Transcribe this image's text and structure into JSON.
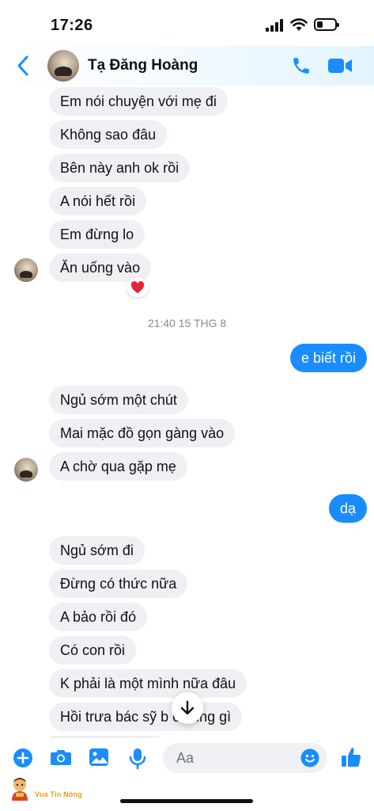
{
  "status_bar": {
    "time": "17:26"
  },
  "header": {
    "contact_name": "Tạ Đăng Hoàng"
  },
  "messages": [
    {
      "dir": "in",
      "text": "Em nói chuyện với mẹ đi"
    },
    {
      "dir": "in",
      "text": "Không sao đâu"
    },
    {
      "dir": "in",
      "text": "Bên này anh ok rồi"
    },
    {
      "dir": "in",
      "text": "A nói hết rồi"
    },
    {
      "dir": "in",
      "text": "Em đừng lo"
    },
    {
      "dir": "in",
      "text": "Ăn uống vào",
      "reaction": "❤️"
    },
    {
      "dir": "in",
      "text": "Ngủ sớm một chút"
    },
    {
      "dir": "in",
      "text": "Mai mặc đồ gọn gàng vào"
    },
    {
      "dir": "in",
      "text": "A chờ qua gặp mẹ"
    },
    {
      "dir": "in",
      "text": "Ngủ sớm đi"
    },
    {
      "dir": "in",
      "text": "Đừng có thức nữa"
    },
    {
      "dir": "in",
      "text": "A bảo rồi đó"
    },
    {
      "dir": "in",
      "text": "Có con rồi"
    },
    {
      "dir": "in",
      "text": "K phải là một mình nữa đâu"
    },
    {
      "dir": "in",
      "text": "Hồi trưa bác sỹ b  ổ sung gì"
    }
  ],
  "sent": [
    {
      "dir": "out",
      "text": "e biết rồi"
    },
    {
      "dir": "out",
      "text": "dạ"
    }
  ],
  "timestamp": "21:40 15 THG 8",
  "composer": {
    "placeholder": "Aa"
  },
  "watermark": {
    "text": "Vua Tin Nóng"
  },
  "colors": {
    "accent": "#1a8cff",
    "incoming_bubble": "#eef0f3",
    "outgoing_bubble": "#1a8cff",
    "watermark": "#e39b12"
  },
  "icons": [
    "back-arrow-icon",
    "phone-icon",
    "video-camera-icon",
    "heart-icon",
    "arrow-down-icon",
    "plus-icon",
    "camera-icon",
    "image-icon",
    "microphone-icon",
    "emoji-icon",
    "thumbs-up-icon"
  ]
}
